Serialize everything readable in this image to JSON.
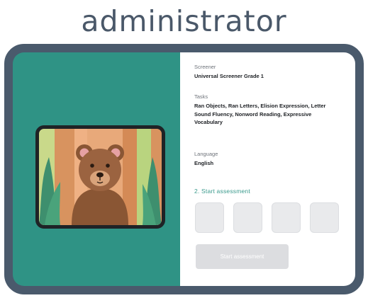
{
  "page": {
    "role_title": "administrator"
  },
  "colors": {
    "device_frame": "#4a5a6c",
    "left_panel": "#2f9385",
    "accent": "#3a9a8c",
    "button_disabled": "#dcdde0",
    "code_box": "#e9eaec"
  },
  "assessment_info": {
    "screener_label": "Screener",
    "screener_value": "Universal Screener Grade 1",
    "tasks_label": "Tasks",
    "tasks_value": "Ran Objects, Ran Letters, Elision Expression, Letter Sound Fluency, Nonword Reading, Expressive Vocabulary",
    "language_label": "Language",
    "language_value": "English"
  },
  "start_section": {
    "step_label": "2. Start assessment",
    "code_boxes": 4,
    "button_label": "Start assessment"
  },
  "illustration": {
    "icon": "bear-illustration"
  }
}
